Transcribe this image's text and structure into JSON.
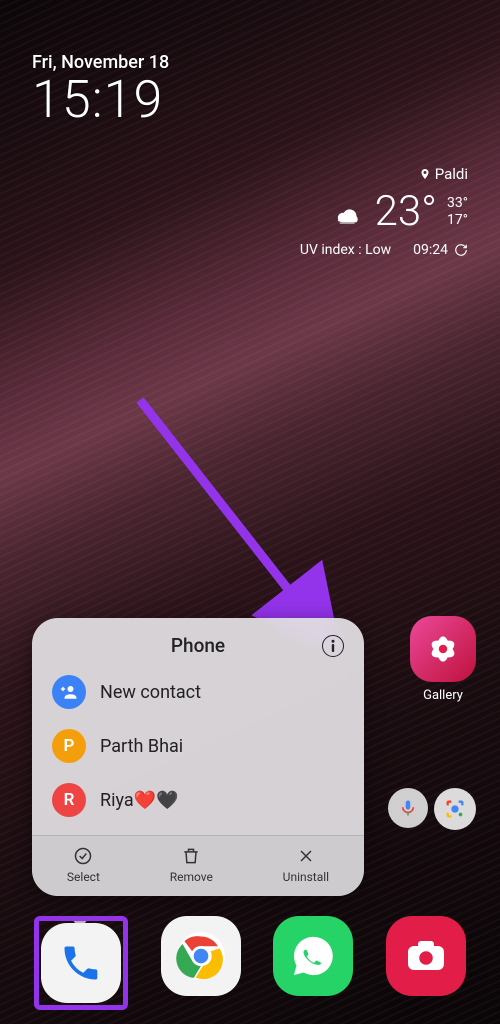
{
  "datetime": {
    "date": "Fri, November 18",
    "time": "15:19"
  },
  "weather": {
    "location": "Paldi",
    "temp": "23°",
    "high": "33°",
    "low": "17°",
    "uv_label": "UV index : Low",
    "time": "09:24"
  },
  "popup": {
    "title": "Phone",
    "items": [
      {
        "avatar_letter": "",
        "label": "New contact",
        "avatar_color": "av-blue",
        "is_add": true
      },
      {
        "avatar_letter": "P",
        "label": "Parth Bhai",
        "avatar_color": "av-orange"
      },
      {
        "avatar_letter": "R",
        "label": "Riya❤️🖤",
        "avatar_color": "av-red"
      }
    ],
    "actions": {
      "select": "Select",
      "remove": "Remove",
      "uninstall": "Uninstall"
    }
  },
  "gallery_label": "Gallery",
  "dock": {
    "phone": "phone-icon",
    "chrome": "chrome-icon",
    "whatsapp": "whatsapp-icon",
    "camera": "camera-icon"
  }
}
